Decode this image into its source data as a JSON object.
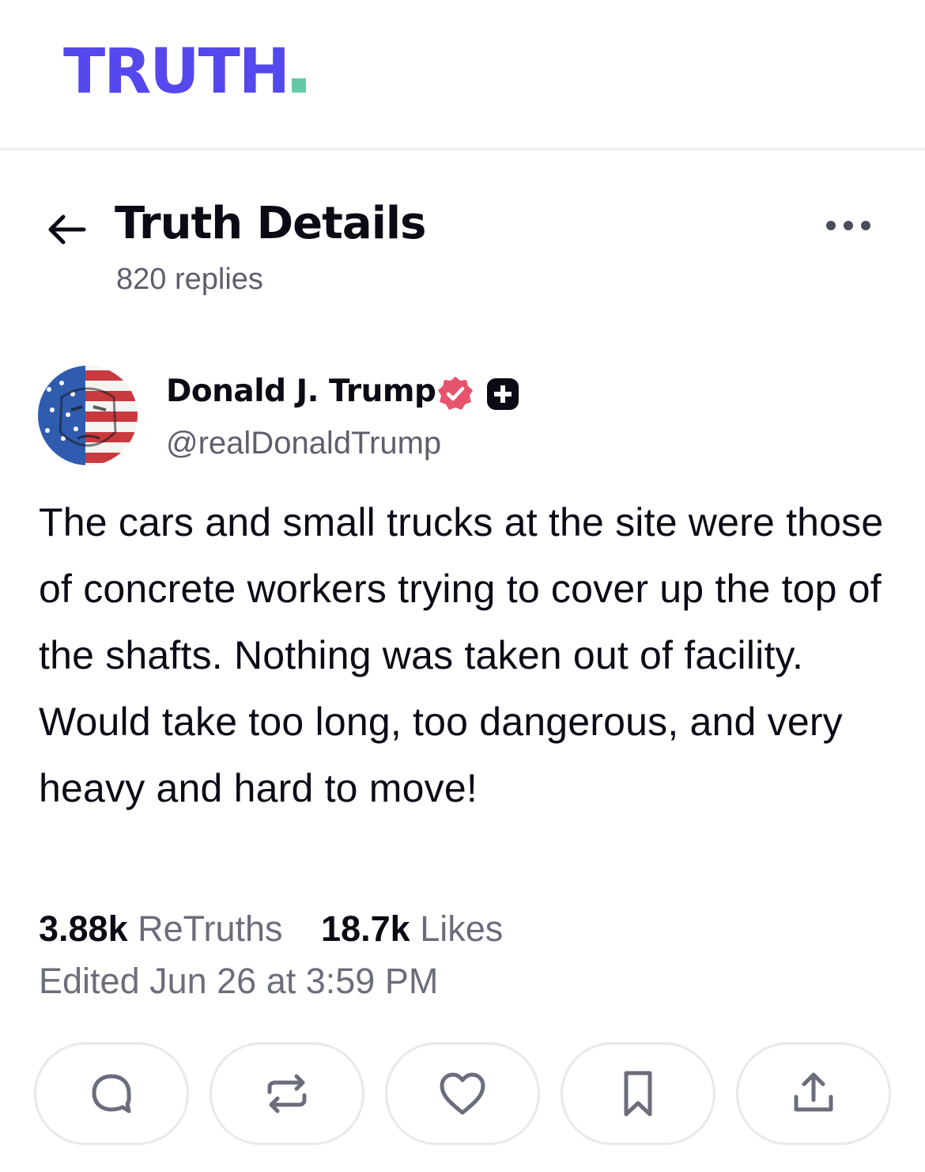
{
  "app": {
    "logo_text": "TRUTH",
    "brand_color": "#5448ee",
    "accent_dot_color": "#65c9a8"
  },
  "header": {
    "title": "Truth Details",
    "subtitle": "820 replies",
    "back_icon": "arrow-left-icon",
    "more_icon": "ellipsis-icon"
  },
  "post": {
    "author_name": "Donald J. Trump",
    "author_handle": "@realDonaldTrump",
    "verified_icon": "verified-badge-icon",
    "verified_color": "#e8546e",
    "plus_icon": "truth-plus-icon",
    "text": "The cars and small trucks at the site were those of concrete workers trying to cover up the top of the shafts. Nothing was taken out of facility. Would take too long, too dangerous, and very heavy and hard to move!",
    "retruths_count": "3.88k",
    "retruths_label": "ReTruths",
    "likes_count": "18.7k",
    "likes_label": "Likes",
    "edited": "Edited Jun 26 at 3:59 PM"
  },
  "actions": [
    {
      "name": "reply-button",
      "icon": "comment-icon"
    },
    {
      "name": "retruth-button",
      "icon": "repost-icon"
    },
    {
      "name": "like-button",
      "icon": "heart-icon"
    },
    {
      "name": "bookmark-button",
      "icon": "bookmark-icon"
    },
    {
      "name": "share-button",
      "icon": "share-icon"
    }
  ]
}
